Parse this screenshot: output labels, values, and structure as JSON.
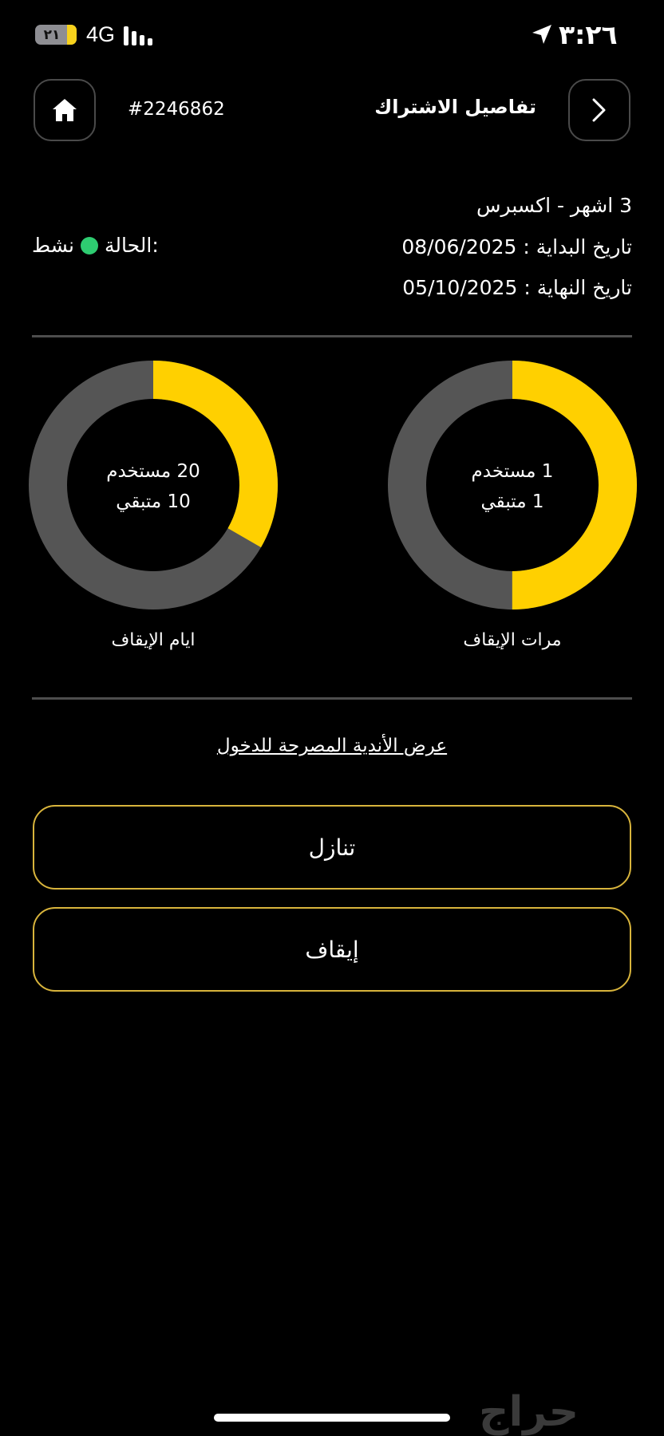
{
  "status_bar": {
    "battery": "٢١",
    "network": "4G",
    "time": "٣:٢٦"
  },
  "header": {
    "title": "تفاصيل الاشتراك",
    "subscription_id": "#2246862"
  },
  "info": {
    "plan": "3 اشهر - اكسبرس",
    "start_date": "تاريخ البداية : 08/06/2025",
    "end_date": "تاريخ النهاية : 05/10/2025",
    "status_label": "الحالة:",
    "status_value": "نشط",
    "status_color": "#2ecc71"
  },
  "freeze_times": {
    "label": "مرات الإيقاف",
    "used": "1 مستخدم",
    "remaining": "1 متبقي",
    "used_value": 1,
    "remaining_value": 1
  },
  "freeze_days": {
    "label": "ايام الإيقاف",
    "used": "20 مستخدم",
    "remaining": "10 متبقي",
    "used_value": 20,
    "remaining_value": 10
  },
  "colors": {
    "accent": "#ffd000",
    "ring_track": "#555555",
    "button_border": "#d8b43c"
  },
  "links": {
    "allowed_clubs": "عرض الأندية المصرحة للدخول"
  },
  "actions": {
    "waive": "تنازل",
    "freeze": "إيقاف"
  },
  "watermark": "حراج"
}
